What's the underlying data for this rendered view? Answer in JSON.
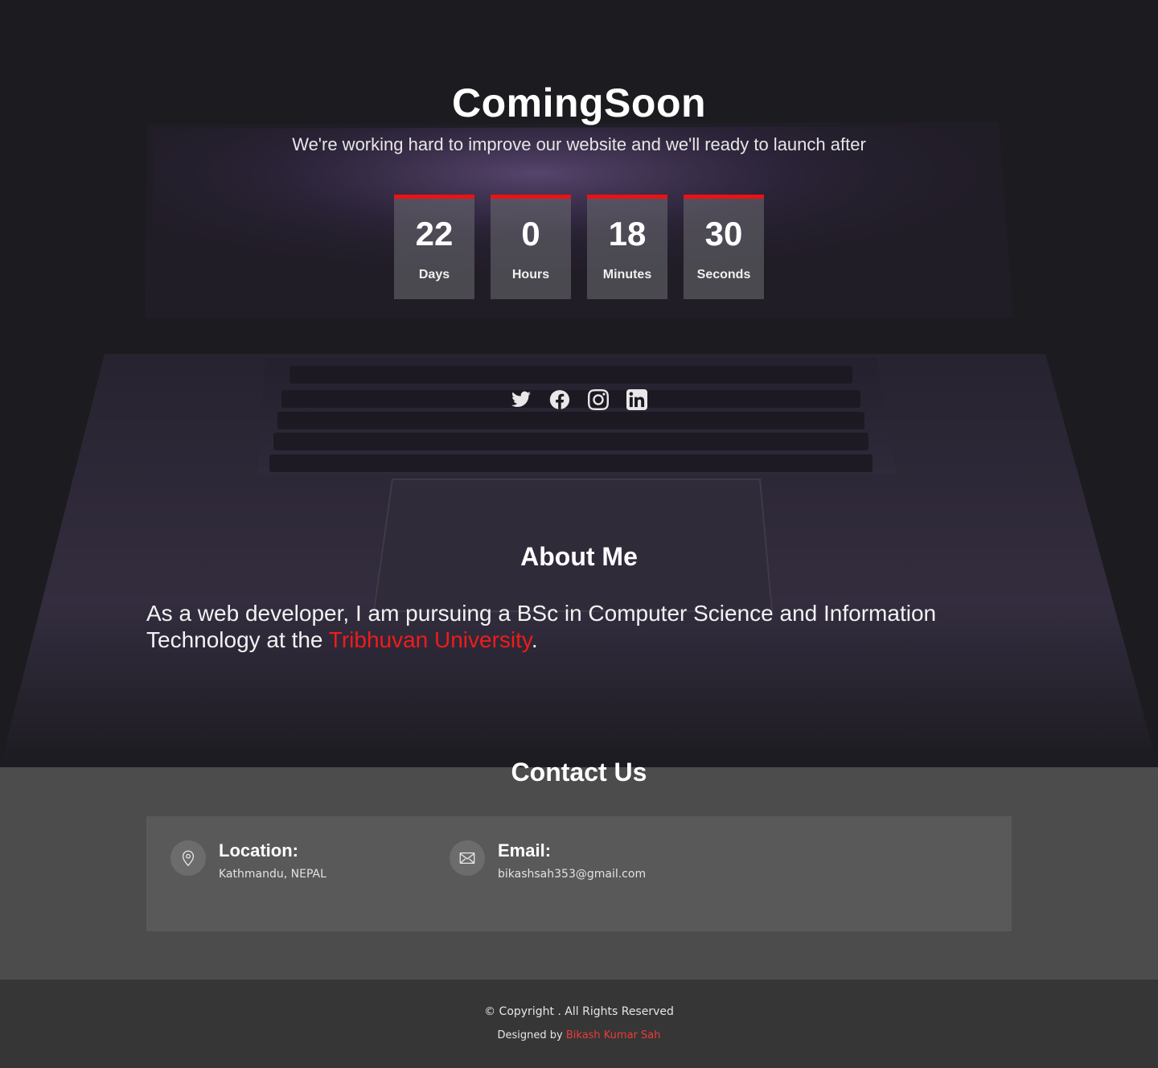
{
  "hero": {
    "title": "ComingSoon",
    "subtitle": "We're working hard to improve our website and we'll ready to launch after",
    "accent_color": "#ee1111"
  },
  "countdown": [
    {
      "value": "22",
      "label": "Days"
    },
    {
      "value": "0",
      "label": "Hours"
    },
    {
      "value": "18",
      "label": "Minutes"
    },
    {
      "value": "30",
      "label": "Seconds"
    }
  ],
  "social": [
    {
      "name": "twitter-icon"
    },
    {
      "name": "facebook-icon"
    },
    {
      "name": "instagram-icon"
    },
    {
      "name": "linkedin-icon"
    }
  ],
  "about": {
    "title": "About Me",
    "text_before": "As a web developer, I am pursuing a BSc in Computer Science and Information Technology at the ",
    "link_text": "Tribhuvan University",
    "text_after": "."
  },
  "contact": {
    "title": "Contact Us",
    "location_label": "Location:",
    "location_value": "Kathmandu, NEPAL",
    "email_label": "Email:",
    "email_value": "bikashsah353@gmail.com"
  },
  "footer": {
    "copyright": "© Copyright . All Rights Reserved",
    "designed_by": "Designed by ",
    "designer": "Bikash Kumar Sah",
    "designer_color": "#ee3a3a"
  }
}
